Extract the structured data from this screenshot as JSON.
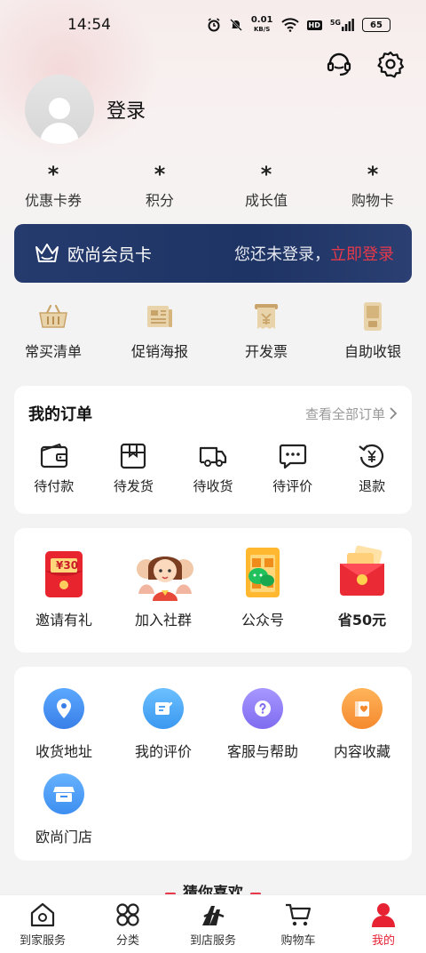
{
  "status_bar": {
    "time": "14:54",
    "net_speed_value": "0.01",
    "net_speed_unit": "KB/S",
    "hd": "HD",
    "signal": "5G",
    "battery": "65"
  },
  "header": {
    "support_icon": "headset-icon",
    "settings_icon": "gear-icon"
  },
  "profile": {
    "login_label": "登录"
  },
  "stats": [
    {
      "value": "*",
      "label": "优惠卡券"
    },
    {
      "value": "*",
      "label": "积分"
    },
    {
      "value": "*",
      "label": "成长值"
    },
    {
      "value": "*",
      "label": "购物卡"
    }
  ],
  "member_card": {
    "title": "欧尚会员卡",
    "prompt": "您还未登录，",
    "cta": "立即登录"
  },
  "quick_actions": [
    {
      "label": "常买清单",
      "icon": "basket-icon"
    },
    {
      "label": "促销海报",
      "icon": "poster-icon"
    },
    {
      "label": "开发票",
      "icon": "invoice-icon"
    },
    {
      "label": "自助收银",
      "icon": "pos-terminal-icon"
    }
  ],
  "orders": {
    "title": "我的订单",
    "view_all": "查看全部订单",
    "items": [
      {
        "label": "待付款",
        "icon": "wallet-icon"
      },
      {
        "label": "待发货",
        "icon": "package-icon"
      },
      {
        "label": "待收货",
        "icon": "truck-icon"
      },
      {
        "label": "待评价",
        "icon": "comment-icon"
      },
      {
        "label": "退款",
        "icon": "refund-icon"
      }
    ]
  },
  "promos": [
    {
      "label": "邀请有礼",
      "badge": "¥30"
    },
    {
      "label": "加入社群"
    },
    {
      "label": "公众号"
    },
    {
      "label": "省50元"
    }
  ],
  "services": [
    {
      "label": "收货地址",
      "icon": "location-icon",
      "color": "#3a8ef0"
    },
    {
      "label": "我的评价",
      "icon": "review-icon",
      "color": "#4aa8f4"
    },
    {
      "label": "客服与帮助",
      "icon": "help-icon",
      "color": "#8f7ef0"
    },
    {
      "label": "内容收藏",
      "icon": "favorite-icon",
      "color": "#f59a3e"
    },
    {
      "label": "欧尚门店",
      "icon": "store-icon",
      "color": "#4a9cf2"
    }
  ],
  "guess": {
    "title": "猜你喜欢"
  },
  "tabbar": [
    {
      "label": "到家服务",
      "icon": "home-icon"
    },
    {
      "label": "分类",
      "icon": "category-icon"
    },
    {
      "label": "到店服务",
      "icon": "auchan-logo-icon"
    },
    {
      "label": "购物车",
      "icon": "cart-icon"
    },
    {
      "label": "我的",
      "icon": "user-icon",
      "active": true
    }
  ],
  "colors": {
    "accent": "#e62233",
    "card_navy": "#1e3464",
    "gold": "#c9a46a"
  }
}
